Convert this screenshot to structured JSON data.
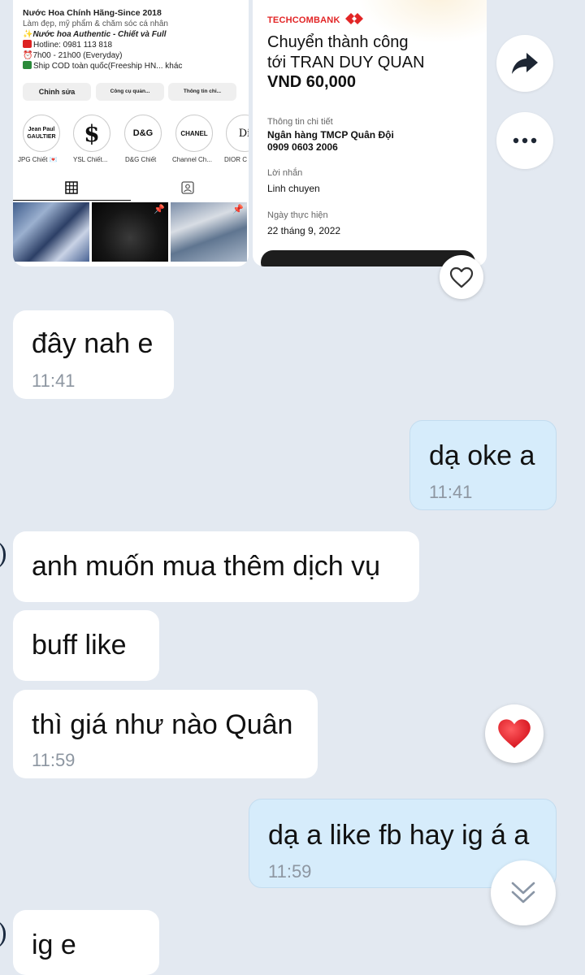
{
  "ig_screenshot": {
    "profile_name": "Nước Hoa Chính Hãng-Since 2018",
    "bio_line_1": "Làm đẹp, mỹ phẩm & chăm sóc cá nhân",
    "bio_line_2": "Nước hoa Authentic - Chiết và Full",
    "bio_line_3": "Hotline: 0981 113 818",
    "bio_line_4": "7h00 - 21h00 (Everyday)",
    "bio_line_5": "Ship COD toàn quốc(Freeship HN... khác",
    "buttons": [
      "Chỉnh sửa",
      "Công cụ quản...",
      "Thông tin chi..."
    ],
    "highlights": [
      {
        "cover": "Jean Paul GAULTIER",
        "label": "JPG Chiết 💌"
      },
      {
        "cover": "$",
        "label": "YSL Chiết..."
      },
      {
        "cover": "D&G",
        "label": "D&G Chiết"
      },
      {
        "cover": "CHANEL",
        "label": "Channel Ch..."
      },
      {
        "cover": "Di",
        "label": "DIOR C"
      }
    ]
  },
  "tcb_screenshot": {
    "bank_logo": "TECHCOMBANK",
    "title": "Chuyển thành công tới TRAN DUY QUAN",
    "title_line_1": "Chuyển thành công",
    "title_line_2": "tới TRAN DUY QUAN",
    "amount": "VND 60,000",
    "detail_label": "Thông tin chi tiết",
    "bank_name": "Ngân hàng TMCP Quân Đội",
    "account": "0909 0603 2006",
    "note_label": "Lời nhắn",
    "note_value": "Linh chuyen",
    "date_label": "Ngày thực hiện",
    "date_value": "22 tháng 9, 2022"
  },
  "messages": [
    {
      "text": "đây nah e",
      "time": "11:41",
      "side": "in"
    },
    {
      "text": "dạ oke a",
      "time": "11:41",
      "side": "out"
    },
    {
      "text": "anh muốn mua thêm dịch vụ",
      "side": "in"
    },
    {
      "text": "buff like",
      "side": "in"
    },
    {
      "text": "thì giá như nào Quân",
      "time": "11:59",
      "side": "in"
    },
    {
      "text": "dạ a like fb hay ig á a",
      "time": "11:59",
      "side": "out"
    },
    {
      "text": "ig e",
      "side": "in"
    }
  ],
  "icons": {
    "share": "share-arrow-icon",
    "more": "more-dots-icon",
    "heart_outline": "heart-outline-icon",
    "heart_filled": "heart-filled-icon",
    "scroll_down": "double-chevron-down-icon"
  },
  "colors": {
    "chat_background": "#e3e9f1",
    "outgoing_bubble": "#d6ecfb",
    "incoming_bubble": "#ffffff",
    "heart_red": "#e8222c",
    "techcombank_red": "#e22526"
  }
}
